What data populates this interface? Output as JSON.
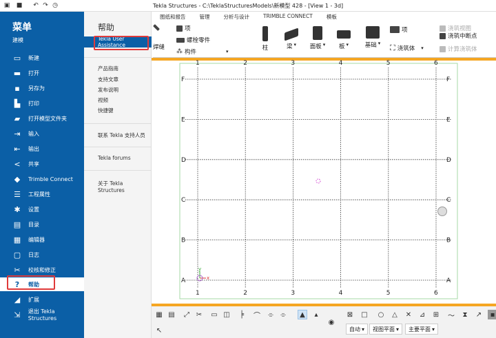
{
  "window": {
    "title": "Tekla Structures - C:\\TeklaStructuresModels\\新模型 428 - [View 1 - 3d]"
  },
  "menu_tabs": [
    "图纸和报告",
    "管理",
    "分析与设计",
    "TRIMBLE CONNECT",
    "模板"
  ],
  "ribbon": {
    "weld_label": "焊缝",
    "item_label": "项",
    "bolt_label": "螺栓零件",
    "component_label": "构件",
    "column_label": "柱",
    "beam_label": "梁",
    "panel_label": "面板",
    "slab_label": "板",
    "foundation_label": "基础",
    "item2_label": "项",
    "pour_label": "浇筑体",
    "pour_view_label": "浇筑视图",
    "pour_break_label": "浇筑中断点",
    "calc_pour_label": "计算浇筑体"
  },
  "sidebar": {
    "header": "菜单",
    "section": "建模",
    "items": [
      {
        "label": "新建",
        "icon": "new-folder-icon"
      },
      {
        "label": "打开",
        "icon": "open-folder-icon"
      },
      {
        "label": "另存为",
        "icon": "save-as-icon"
      },
      {
        "label": "打印",
        "icon": "print-icon"
      },
      {
        "label": "打开模型文件夹",
        "icon": "model-folder-icon"
      },
      {
        "label": "输入",
        "icon": "import-icon"
      },
      {
        "label": "输出",
        "icon": "export-icon"
      },
      {
        "label": "共享",
        "icon": "share-icon"
      },
      {
        "label": "Trimble Connect",
        "icon": "trimble-connect-icon"
      },
      {
        "label": "工程属性",
        "icon": "project-properties-icon"
      },
      {
        "label": "设置",
        "icon": "settings-icon"
      },
      {
        "label": "目录",
        "icon": "catalog-icon"
      },
      {
        "label": "编辑器",
        "icon": "editor-icon"
      },
      {
        "label": "日志",
        "icon": "log-icon"
      },
      {
        "label": "校核和修正",
        "icon": "check-fix-icon"
      },
      {
        "label": "帮助",
        "icon": "help-icon"
      },
      {
        "label": "扩展",
        "icon": "extensions-icon"
      },
      {
        "label": "退出 Tekla Structures",
        "icon": "exit-icon"
      }
    ]
  },
  "help_panel": {
    "header": "帮助",
    "selected": "Tekla User Assistance",
    "group1": [
      "产品指南",
      "支持文章",
      "发布说明",
      "视频",
      "快捷键"
    ],
    "contact": "联系 Tekla 支持人员",
    "forums": "Tekla forums",
    "about": "关于 Tekla Structures"
  },
  "view": {
    "columns": [
      "1",
      "2",
      "3",
      "4",
      "5",
      "6"
    ],
    "rows": [
      "F",
      "E",
      "D",
      "C",
      "B",
      "A"
    ]
  },
  "toolbar": {
    "dropdowns": [
      "自动",
      "视图平面",
      "主要平面"
    ]
  },
  "colors": {
    "sidebar_bg": "#0b5fa6",
    "highlight": "#e03a3a",
    "accent_bar": "#f5a623"
  }
}
